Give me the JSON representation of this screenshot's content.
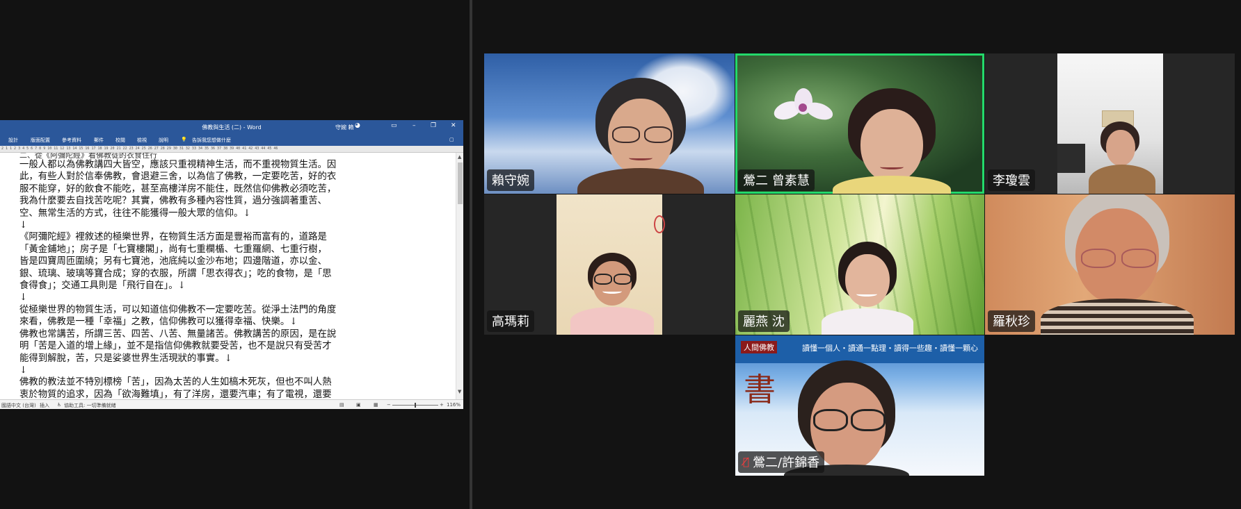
{
  "colors": {
    "background": "#131313",
    "divider": "#343434",
    "word_blue": "#2b579a",
    "active_speaker": "#23d96b",
    "muted_mic": "#ff3b3b"
  },
  "word": {
    "title": "佛教與生活 (二) - Word",
    "user": "守婉 賴",
    "ribbon_tabs": [
      "設計",
      "版面配置",
      "參考資料",
      "郵件",
      "校閱",
      "檢視",
      "說明"
    ],
    "tell_me": "告訴我您想做什麼",
    "ruler_text": "2 1 1 2 3 4 5 6 7 8 9 10 11 12 13 14 15 16 17 18 19 20 21 22 23 24 25 26 27 28 29 30 31 32 33 34 35 36 37 38 39 40 41 42 43 44 45 46",
    "doc_partial_line": "二、從《阿彌陀經》看佛教徒的衣食住行",
    "doc_lines": [
      "一般人都以為佛教講四大皆空，應該只重視精神生活，而不重視物質生活。因",
      "此，有些人對於信奉佛教，會退避三舍，以為信了佛教，一定要吃苦，好的衣",
      "服不能穿，好的飲食不能吃，甚至高樓洋房不能住，既然信仰佛教必須吃苦，",
      "我為什麼要去自找苦吃呢？其實，佛教有多種內容性質，過分強調著重苦、",
      "空、無常生活的方式，往往不能獲得一般大眾的信仰。↓",
      "↓",
      "《阿彌陀經》裡敘述的極樂世界，在物質生活方面是豐裕而富有的，道路是",
      "「黃金鋪地」；房子是「七寶樓閣」，尚有七重欄楯、七重羅網、七重行樹，",
      "皆是四寶周匝圍繞；另有七寶池，池底純以金沙布地；四邊階道，亦以金、",
      "銀、琉璃、玻璃等寶合成；穿的衣服，所謂「思衣得衣」；吃的食物，是「思",
      "食得食」；交通工具則是「飛行自在」。↓",
      "↓",
      "從極樂世界的物質生活，可以知道信仰佛教不一定要吃苦。從淨土法門的角度",
      "來看，佛教是一種「幸福」之教，信仰佛教可以獲得幸福、快樂。↓",
      "佛教也常講苦，所謂三苦、四苦、八苦、無量諸苦。佛教講苦的原因，是在說",
      "明「苦是入道的增上緣」，並不是指信仰佛教就要受苦，也不是說只有受苦才",
      "能得到解脫，苦，只是娑婆世界生活現狀的事實。↓",
      "↓",
      "佛教的教法並不特別標榜「苦」，因為太苦的人生如槁木死灰，但也不叫人熱",
      "衷於物質的追求，因為「欲海難填」，有了洋房，還要汽車；有了電視，還要"
    ],
    "status": {
      "language": "國語中文 (台灣)",
      "insert": "插入",
      "accessibility": "協助工具: 一切準備就緒",
      "zoom": "116%"
    }
  },
  "gallery": {
    "participants": [
      {
        "name": "賴守婉",
        "muted": false,
        "active": false
      },
      {
        "name": "鶯二 曾素慧",
        "muted": false,
        "active": true
      },
      {
        "name": "李瓊雲",
        "muted": false,
        "active": false
      },
      {
        "name": "高瑪莉",
        "muted": false,
        "active": false
      },
      {
        "name": "麗燕 沈",
        "muted": false,
        "active": false
      },
      {
        "name": "羅秋珍",
        "muted": false,
        "active": false
      },
      {
        "name": "鶯二/許錦香",
        "muted": true,
        "active": false
      }
    ],
    "banner_text": "人間佛教",
    "banner_slogan": "讀懂一個人・讀通一點理・讀得一些趣・讀懂一顆心",
    "tile_icons": [
      "mic-muted-icon"
    ]
  }
}
